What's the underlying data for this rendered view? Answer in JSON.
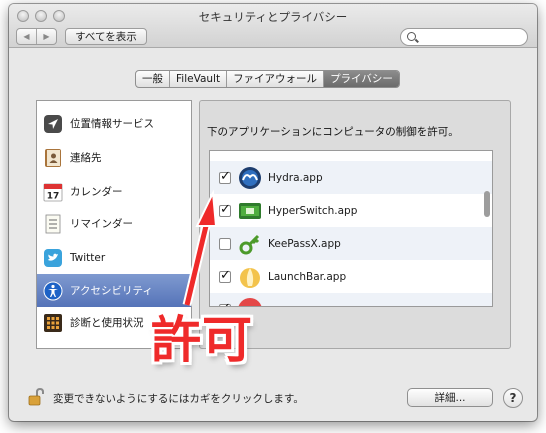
{
  "window": {
    "title": "セキュリティとプライバシー"
  },
  "toolbar": {
    "back_glyph": "◀",
    "forward_glyph": "▶",
    "show_all_label": "すべてを表示",
    "search_placeholder": ""
  },
  "tabs": [
    {
      "label": "一般",
      "active": false
    },
    {
      "label": "FileVault",
      "active": false
    },
    {
      "label": "ファイアウォール",
      "active": false
    },
    {
      "label": "プライバシー",
      "active": true
    }
  ],
  "sidebar": {
    "items": [
      {
        "label": "位置情報サービス",
        "icon": "location-arrow-icon",
        "selected": false
      },
      {
        "label": "連絡先",
        "icon": "contacts-book-icon",
        "selected": false
      },
      {
        "label": "カレンダー",
        "icon": "calendar-icon",
        "calendar_day": "17",
        "selected": false
      },
      {
        "label": "リマインダー",
        "icon": "reminders-list-icon",
        "selected": false
      },
      {
        "label": "Twitter",
        "icon": "twitter-bird-icon",
        "selected": false
      },
      {
        "label": "アクセシビリティ",
        "icon": "accessibility-icon",
        "selected": true
      },
      {
        "label": "診断と使用状況",
        "icon": "diagnostics-icon",
        "selected": false
      }
    ]
  },
  "main": {
    "header": "下のアプリケーションにコンピュータの制御を許可。",
    "apps": [
      {
        "name": "Hydra.app",
        "checked": true,
        "icon": "hydra-app-icon"
      },
      {
        "name": "HyperSwitch.app",
        "checked": true,
        "icon": "hyperswitch-app-icon"
      },
      {
        "name": "KeePassX.app",
        "checked": false,
        "icon": "keepassx-key-icon"
      },
      {
        "name": "LaunchBar.app",
        "checked": true,
        "icon": "launchbar-icon"
      }
    ]
  },
  "bottom": {
    "lock_text": "変更できないようにするにはカギをクリックします。",
    "advanced_label": "詳細...",
    "help_label": "?"
  },
  "annotation": {
    "text": "許可",
    "color": "#ef2a2a"
  }
}
